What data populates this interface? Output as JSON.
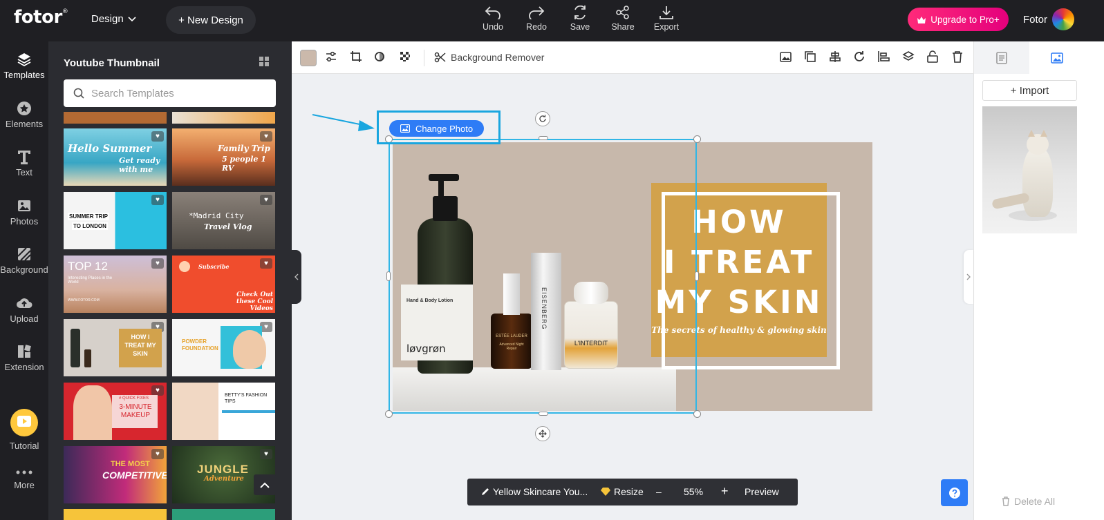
{
  "app": {
    "logo": "fotor",
    "logo_mark": "®"
  },
  "topbar": {
    "design_menu": "Design",
    "new_design": "+ New Design",
    "tools": [
      {
        "label": "Undo",
        "icon": "undo-icon"
      },
      {
        "label": "Redo",
        "icon": "redo-icon"
      },
      {
        "label": "Save",
        "icon": "save-icon"
      },
      {
        "label": "Share",
        "icon": "share-icon"
      },
      {
        "label": "Export",
        "icon": "export-icon"
      }
    ],
    "upgrade": "Upgrade to Pro+",
    "username": "Fotor"
  },
  "leftnav": {
    "items": [
      {
        "label": "Templates",
        "icon": "templates-icon"
      },
      {
        "label": "Elements",
        "icon": "elements-icon"
      },
      {
        "label": "Text",
        "icon": "text-icon"
      },
      {
        "label": "Photos",
        "icon": "photos-icon"
      },
      {
        "label": "Background",
        "icon": "background-icon"
      },
      {
        "label": "Upload",
        "icon": "upload-icon"
      },
      {
        "label": "Extension",
        "icon": "extension-icon"
      },
      {
        "label": "Tutorial",
        "icon": "tutorial-icon"
      },
      {
        "label": "More",
        "icon": "more-icon"
      }
    ]
  },
  "templates_panel": {
    "title": "Youtube Thumbnail",
    "search_placeholder": "Search Templates",
    "thumbnails": [
      {
        "text": "Hello Summer",
        "text2": "Get ready with me",
        "bg": "#3fb2c9"
      },
      {
        "text": "Family Trip",
        "text2": "5 people 1 RV",
        "bg": "#d9793f"
      },
      {
        "text": "SUMMER TRIP",
        "text2": "TO LONDON",
        "bg": "#48c4e0"
      },
      {
        "text": "*Madrid City",
        "text2": "Travel Vlog",
        "bg": "#5d564f"
      },
      {
        "text": "TOP 12",
        "text2": "Interesting Places in the World",
        "text3": "WWW.FOTOR.COM",
        "bg": "#c7a48e"
      },
      {
        "text": "Subscribe",
        "text2": "Check Out these Cool Videos",
        "bg": "#f04d2d"
      },
      {
        "text": "HOW I TREAT MY SKIN",
        "bg": "#d6d0ca"
      },
      {
        "text": "POWDER FOUNDATION",
        "bg": "#f4f4f4"
      },
      {
        "text": "3-MINUTE MAKEUP",
        "text2": "# QUICK FIXES",
        "bg": "#d7262e"
      },
      {
        "text": "BETTY'S FASHION TIPS",
        "bg": "#f1e4da"
      },
      {
        "text": "THE MOST",
        "text2": "COMPETITIVE",
        "bg": "#6a2d6e"
      },
      {
        "text": "JUNGLE",
        "text2": "Adventure",
        "bg": "#2b4a2a"
      }
    ]
  },
  "canvas_toolbar": {
    "background_remover": "Background Remover",
    "swatch_color": "#cbb9ab"
  },
  "canvas": {
    "change_photo": "Change Photo",
    "headline": [
      "HOW",
      "I TREAT",
      "MY SKIN"
    ],
    "subline": "The secrets of healthy & glowing skin",
    "bottle_labels": {
      "lotion_brand": "løvgrøn",
      "lotion_name": "Hand & Body Lotion",
      "serum_brand": "ESTÉE LAUDER",
      "serum_name": "Advanced Night Repair",
      "tube_brand": "EISENBERG",
      "perfume": "L'INTERDIT"
    },
    "accent": "#d2a24c"
  },
  "bottombar": {
    "title": "Yellow Skincare You...",
    "resize": "Resize",
    "zoom_minus": "–",
    "zoom": "55%",
    "zoom_plus": "+",
    "preview": "Preview"
  },
  "rightpanel": {
    "import": "+ Import",
    "delete_all": "Delete All"
  }
}
